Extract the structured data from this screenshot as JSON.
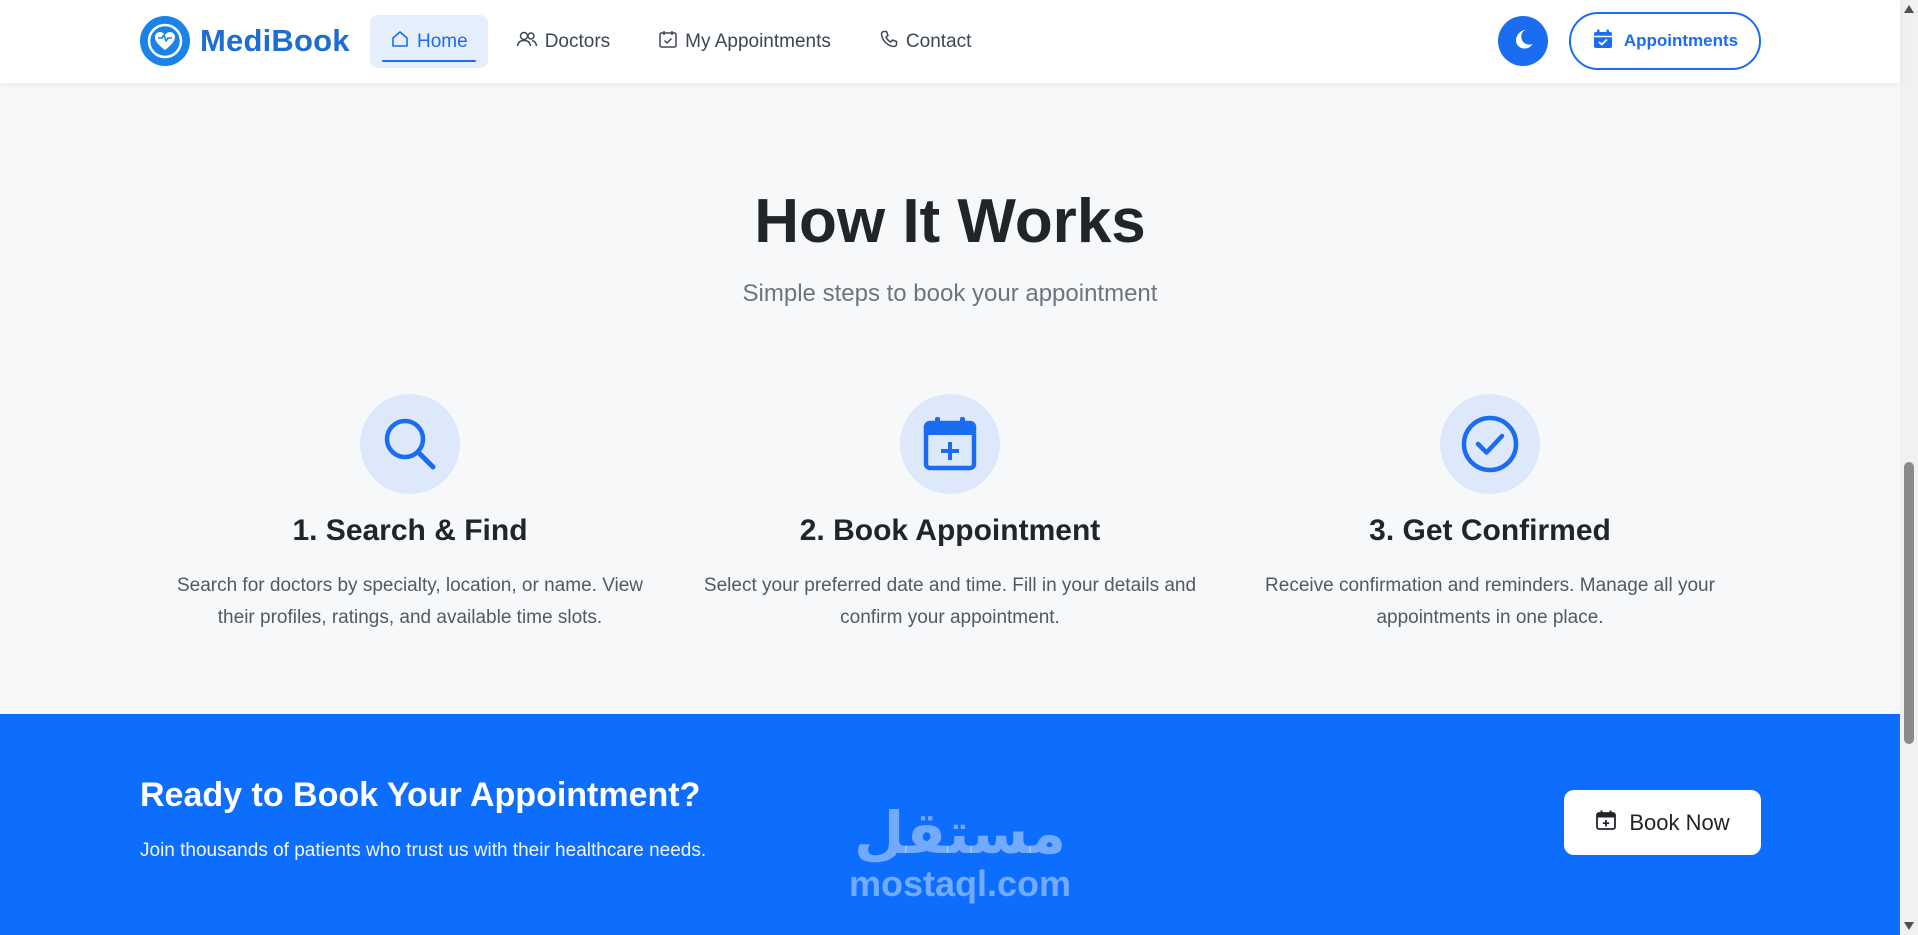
{
  "colors": {
    "primary": "#0d6efd",
    "brand": "#1d6ed0",
    "nav_active_bg": "#e4eefc",
    "icon_circle_bg": "#dde8fa"
  },
  "navbar": {
    "brand_name": "MediBook",
    "brand_icon": "heart-shield-icon",
    "links": [
      {
        "label": "Home",
        "icon": "home-icon",
        "active": true
      },
      {
        "label": "Doctors",
        "icon": "users-icon",
        "active": false
      },
      {
        "label": "My Appointments",
        "icon": "calendar-check-icon",
        "active": false
      },
      {
        "label": "Contact",
        "icon": "phone-icon",
        "active": false
      }
    ],
    "theme_toggle_icon": "moon-icon",
    "appointments_button": {
      "label": "Appointments",
      "icon": "calendar-check-icon"
    }
  },
  "how_it_works": {
    "title": "How It Works",
    "subtitle": "Simple steps to book your appointment",
    "steps": [
      {
        "icon": "search-icon",
        "title": "1. Search & Find",
        "description": "Search for doctors by specialty, location, or name. View their profiles, ratings, and available time slots."
      },
      {
        "icon": "calendar-plus-icon",
        "title": "2. Book Appointment",
        "description": "Select your preferred date and time. Fill in your details and confirm your appointment."
      },
      {
        "icon": "check-circle-icon",
        "title": "3. Get Confirmed",
        "description": "Receive confirmation and reminders. Manage all your appointments in one place."
      }
    ]
  },
  "cta": {
    "title": "Ready to Book Your Appointment?",
    "text": "Join thousands of patients who trust us with their healthcare needs.",
    "button": {
      "label": "Book Now",
      "icon": "calendar-plus-icon"
    }
  },
  "watermark": {
    "arabic": "مستقل",
    "latin": "mostaql.com"
  }
}
